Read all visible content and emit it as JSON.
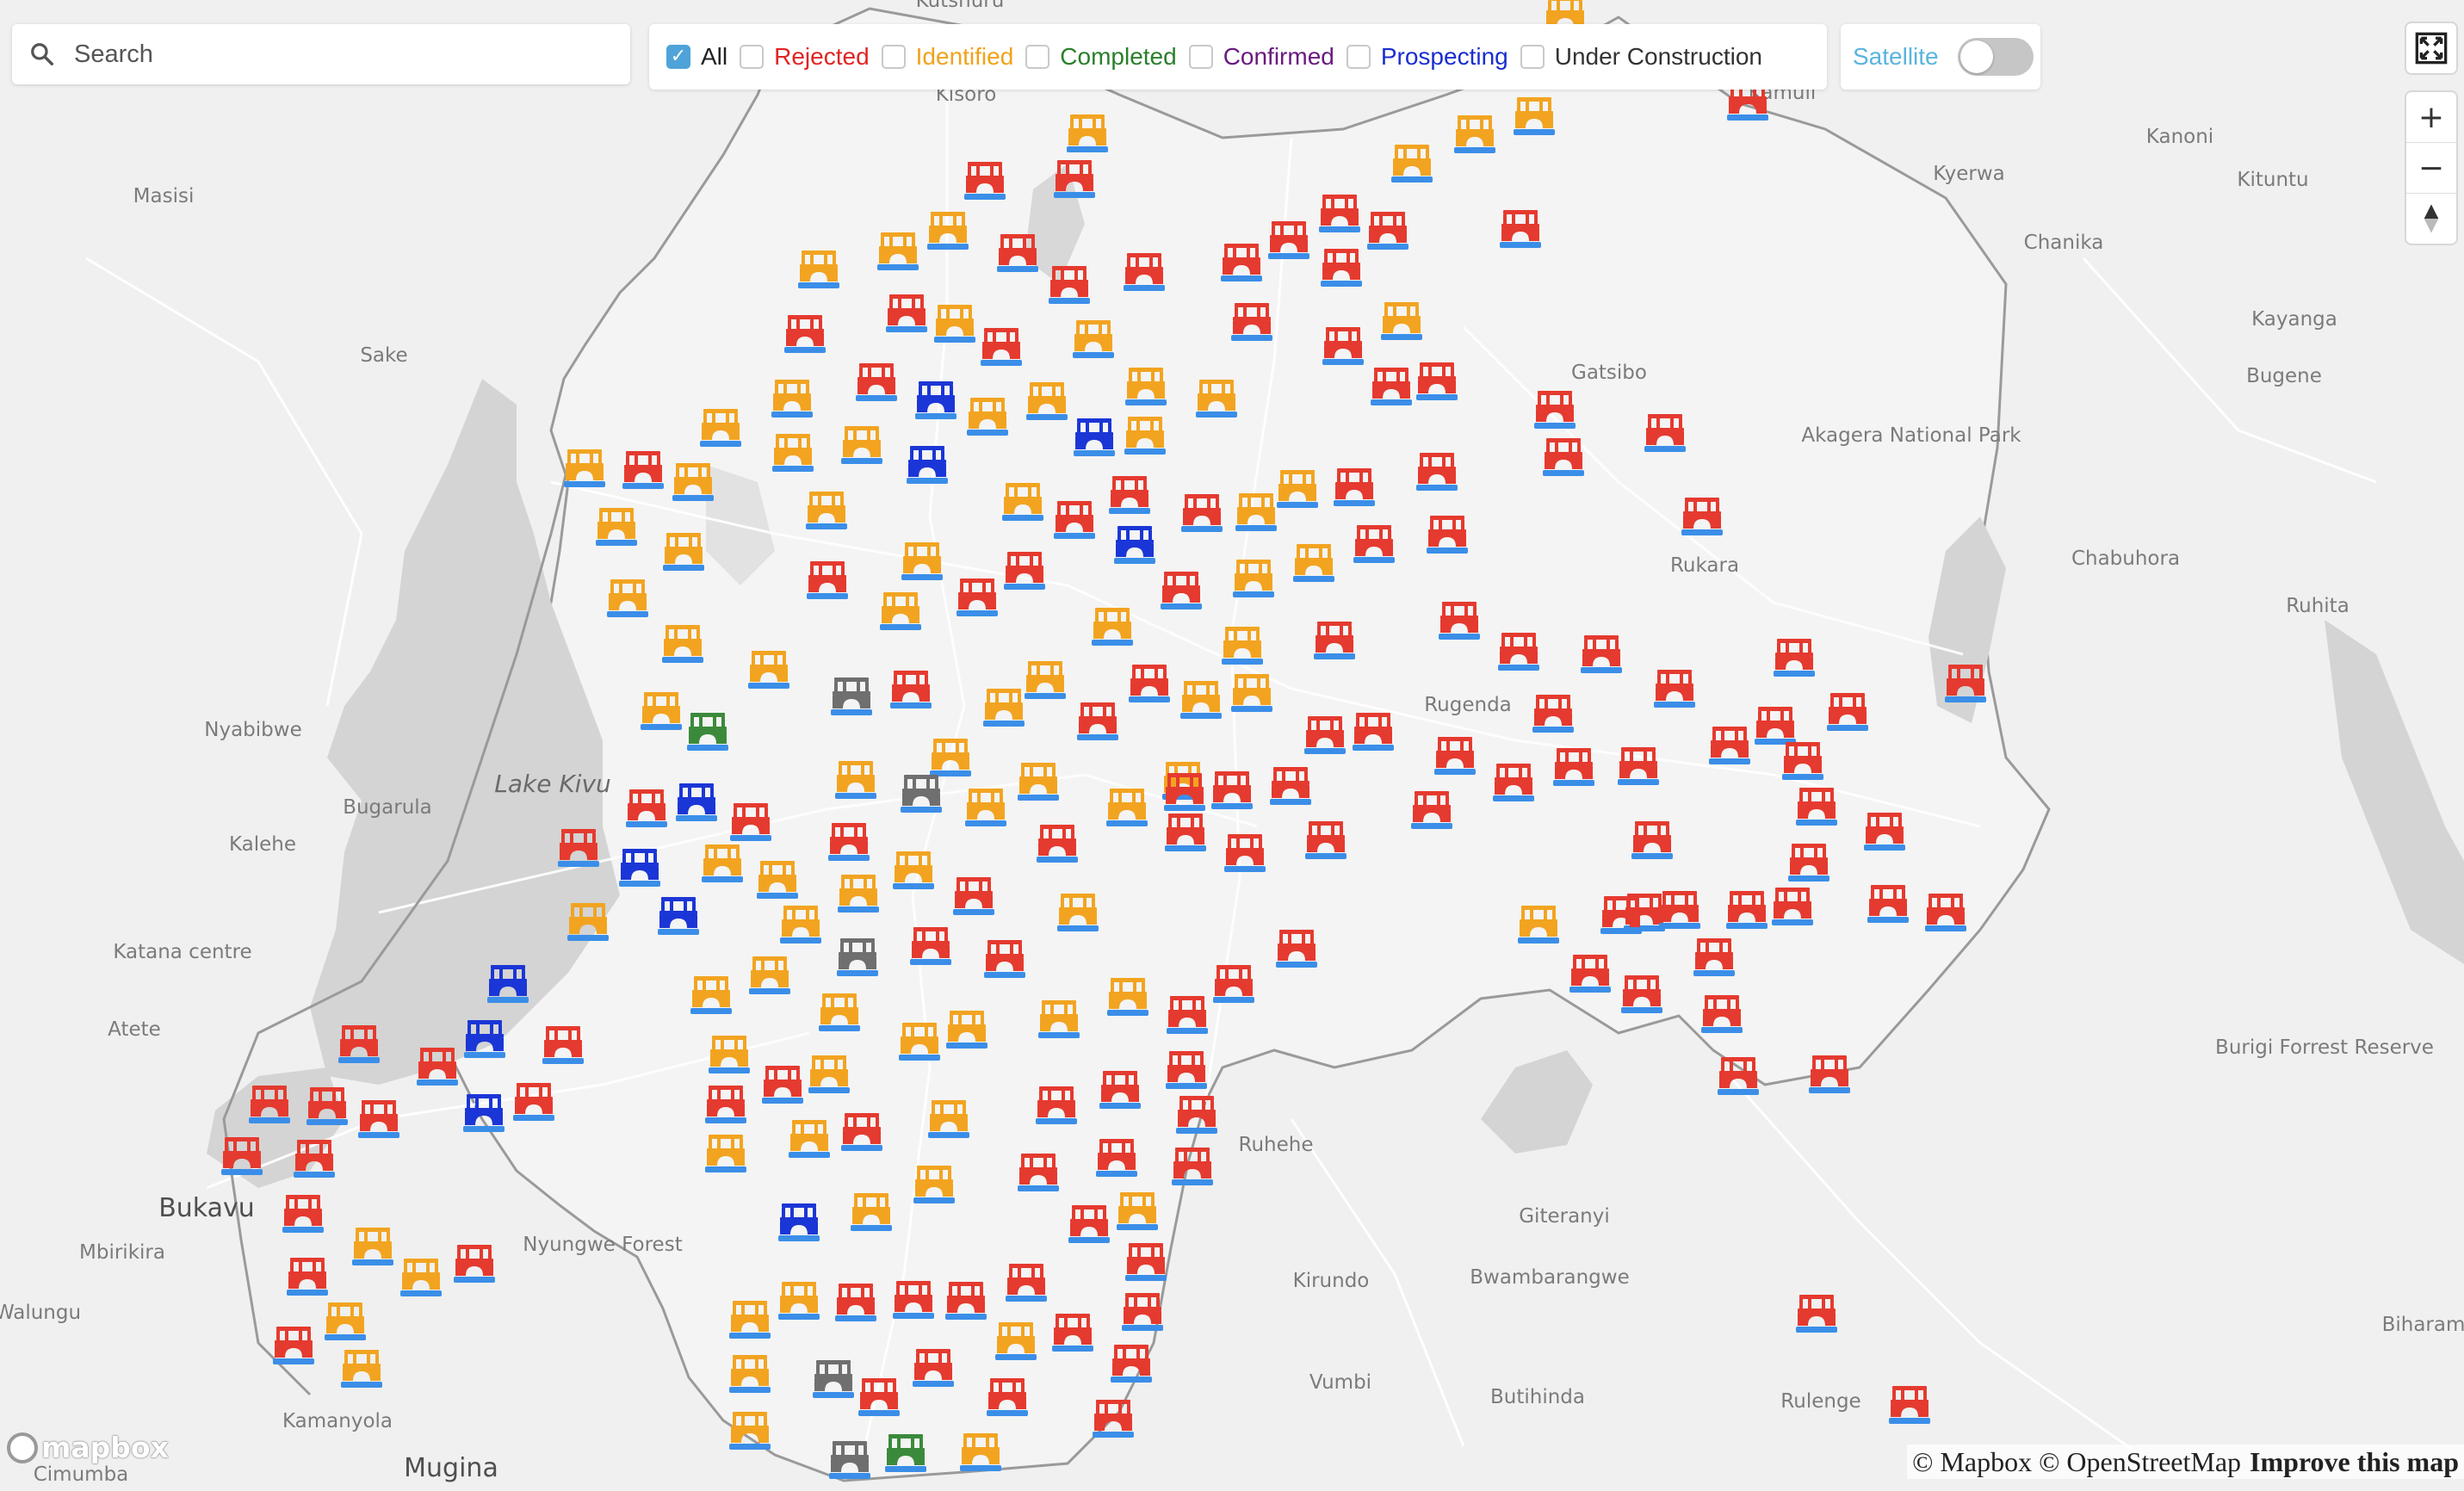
{
  "search": {
    "placeholder": "Search",
    "value": ""
  },
  "filters": [
    {
      "key": "all",
      "label": "All",
      "checked": true,
      "color": "#222222"
    },
    {
      "key": "rejected",
      "label": "Rejected",
      "checked": false,
      "color": "#e02424"
    },
    {
      "key": "identified",
      "label": "Identified",
      "checked": false,
      "color": "#f0a21a"
    },
    {
      "key": "completed",
      "label": "Completed",
      "checked": false,
      "color": "#2a7f2a"
    },
    {
      "key": "confirmed",
      "label": "Confirmed",
      "checked": false,
      "color": "#6a1a80"
    },
    {
      "key": "prospecting",
      "label": "Prospecting",
      "checked": false,
      "color": "#1a2ed0"
    },
    {
      "key": "under_construction",
      "label": "Under Construction",
      "checked": false,
      "color": "#333333"
    }
  ],
  "satellite": {
    "label": "Satellite",
    "on": false,
    "color": "#5ab4de"
  },
  "controls": {
    "fullscreen_icon": "fullscreen-icon",
    "zoom_in_icon": "plus-icon",
    "zoom_out_icon": "minus-icon",
    "compass_icon": "compass-icon"
  },
  "mapbox_logo": "mapbox",
  "attribution": {
    "text": "© Mapbox © OpenStreetMap",
    "improve": "Improve this map"
  },
  "colors": {
    "rejected": "#e53a2f",
    "identified": "#f2a421",
    "completed": "#3b8a3b",
    "prospecting": "#1b36d6",
    "under_construction": "#6f6f6f",
    "water_bar": "#3b8ee8"
  },
  "place_labels": [
    "Kutshuru",
    "Kisoro",
    "Kamuli",
    "Kanoni",
    "Kyerwa",
    "Kituntu",
    "Masisi",
    "Chanika",
    "Kayanga",
    "Sake",
    "Gatsibo",
    "Bugene",
    "Akagera National Park",
    "Rukara",
    "Chabuhora",
    "Ruhita",
    "Rugenda",
    "Nyabibwe",
    "Lake Kivu",
    "Bugarula",
    "Kalehe",
    "Katana centre",
    "Atete",
    "Burigi Forrest Reserve",
    "Ruhehe",
    "Bukavu",
    "Mbirikira",
    "Nyungwe Forest",
    "Giteranyi",
    "Walungu",
    "Kirundo",
    "Bwambarangwe",
    "Biharam",
    "Vumbi",
    "Butihinda",
    "Rulenge",
    "Kamanyola",
    "Mugina",
    "Cimumba"
  ]
}
